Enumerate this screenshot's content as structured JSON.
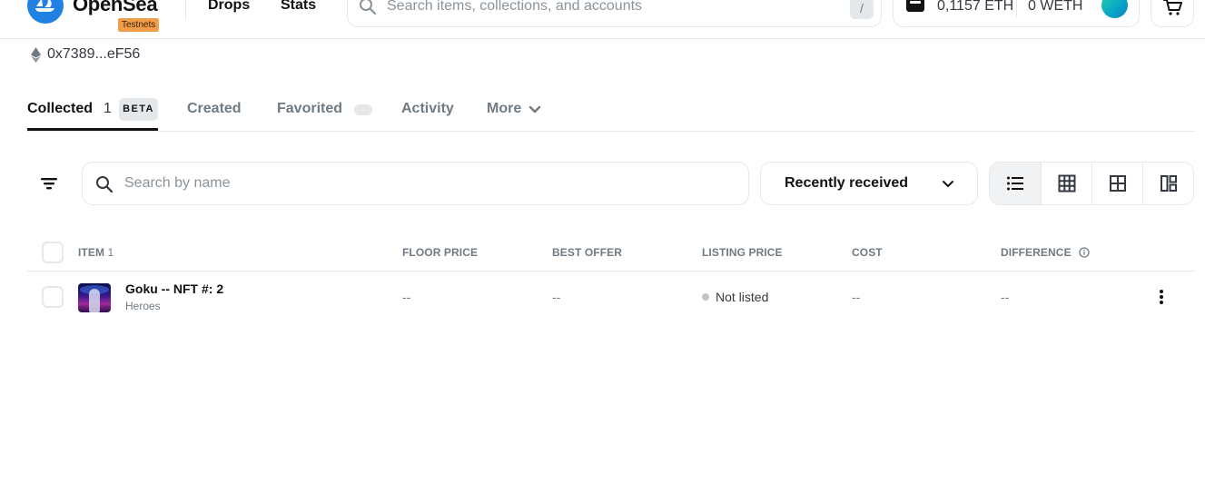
{
  "header": {
    "brand": "OpenSea",
    "badge": "Testnets",
    "nav": {
      "drops": "Drops",
      "stats": "Stats"
    },
    "search": {
      "placeholder": "Search items, collections, and accounts",
      "shortcut": "/"
    },
    "wallet": {
      "eth_balance": "0,1157 ETH",
      "weth_balance": "0 WETH"
    },
    "icons": [
      "opensea-logo-icon",
      "search-icon",
      "wallet-icon",
      "avatar",
      "cart-icon"
    ],
    "accent_color": "#2081e2"
  },
  "profile": {
    "address": "0x7389...eF56",
    "chain_icon": "ethereum-icon"
  },
  "tabs": {
    "collected": {
      "label": "Collected",
      "count": "1",
      "badge": "BETA",
      "active": true
    },
    "created": {
      "label": "Created"
    },
    "favorited": {
      "label": "Favorited"
    },
    "activity": {
      "label": "Activity"
    },
    "more": {
      "label": "More"
    }
  },
  "toolbar": {
    "search_placeholder": "Search by name",
    "sort_selected": "Recently received",
    "view_modes": [
      "list-view-icon",
      "grid-small-icon",
      "grid-large-icon",
      "grid-mixed-icon"
    ],
    "active_view": "list-view-icon"
  },
  "table": {
    "columns": {
      "item": "ITEM",
      "item_count": "1",
      "floor_price": "FLOOR PRICE",
      "best_offer": "BEST OFFER",
      "listing_price": "LISTING PRICE",
      "cost": "COST",
      "difference": "DIFFERENCE"
    },
    "rows": [
      {
        "name": "Goku -- NFT #: 2",
        "collection": "Heroes",
        "floor_price": "--",
        "best_offer": "--",
        "listing_price": "Not listed",
        "cost": "--",
        "difference": "--"
      }
    ]
  }
}
